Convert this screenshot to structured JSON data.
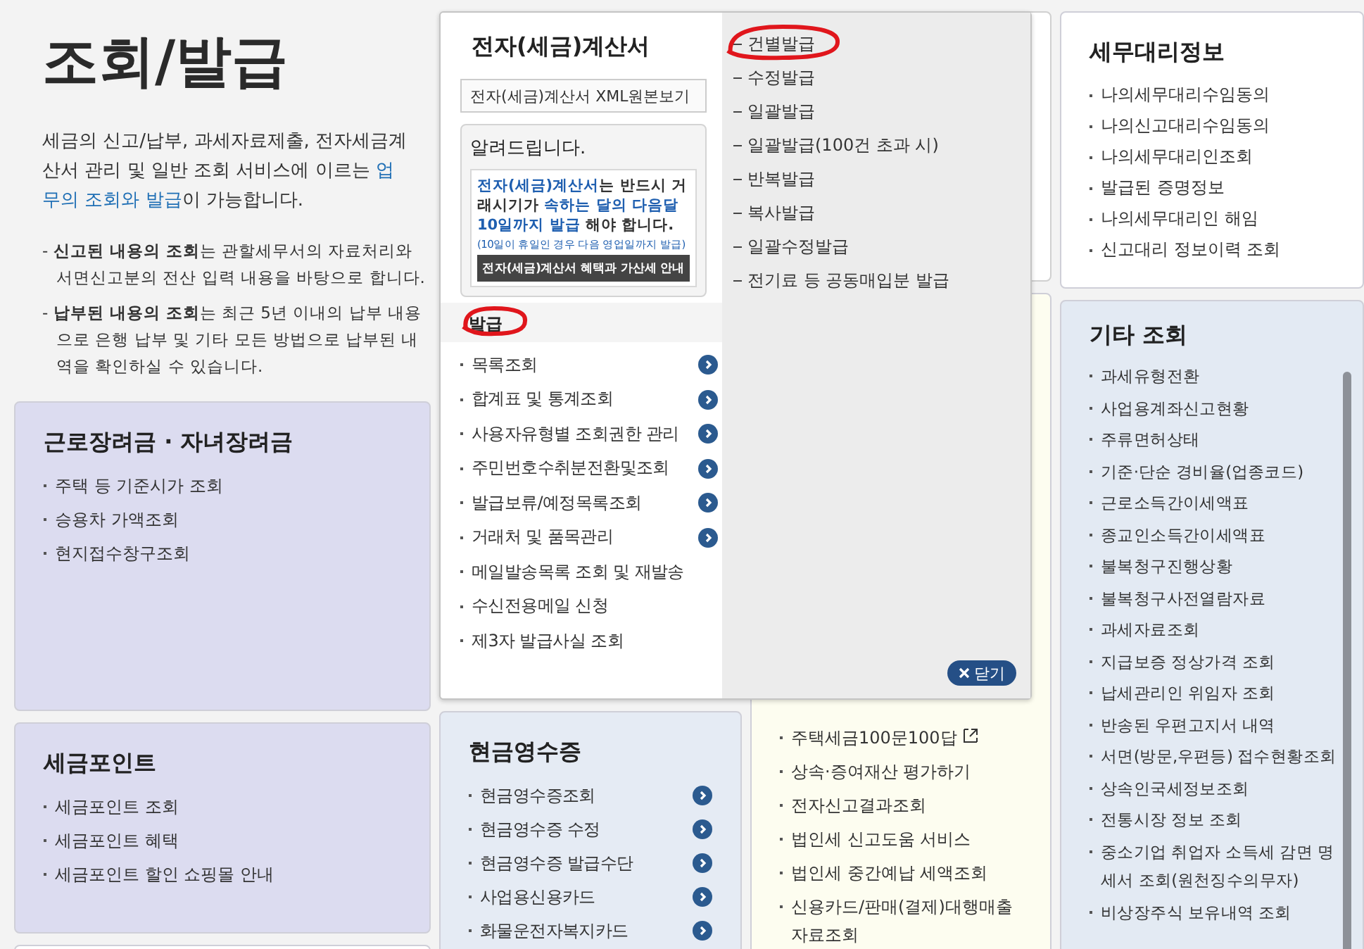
{
  "intro": {
    "title": "조회/발급",
    "description": "세금의 신고/납부, 과세자료제출, 전자세금계산서 관리 및 일반 조회 서비스에 이르는 **업무의 조회와 발급**이 가능합니다.",
    "notes": [
      "- **신고된 내용의 조회**는 관할세무서의 자료처리와 서면신고분의 전산 입력 내용을 바탕으로 합니다.",
      "- **납부된 내용의 조회**는 최근 5년 이내의 납부 내용으로 은행 납부 및 기타 모든 방법으로 납부된 내역을 확인하실 수 있습니다."
    ]
  },
  "left_cards": [
    {
      "title": "근로장려금 · 자녀장려금",
      "items": [
        "주택 등 기준시가 조회",
        "승용차 가액조회",
        "현지접수창구조회"
      ]
    },
    {
      "title": "세금포인트",
      "items": [
        "세금포인트 조회",
        "세금포인트 혜택",
        "세금포인트 할인 쇼핑몰 안내"
      ]
    }
  ],
  "popup": {
    "title": "전자(세금)계산서",
    "xml_button": "전자(세금)계산서 XML원본보기",
    "notice": {
      "title": "알려드립니다.",
      "text": "**전자(세금)계산서**는 반드시 거래시기가 **속하는 달의 다음달 10일까지 발급** 해야 합니다.",
      "footnote": "(10일이 휴일인 경우 다음 영업일까지 발급)",
      "button": "전자(세금)계산서 혜택과 가산세 안내"
    },
    "section": {
      "label": "발급",
      "highlighted": true
    },
    "menu": [
      {
        "label": "목록조회",
        "has_arrow": true
      },
      {
        "label": "합계표 및 통계조회",
        "has_arrow": true
      },
      {
        "label": "사용자유형별 조회권한 관리",
        "has_arrow": true
      },
      {
        "label": "주민번호수취분전환및조회",
        "has_arrow": true
      },
      {
        "label": "발급보류/예정목록조회",
        "has_arrow": true
      },
      {
        "label": "거래처 및 품목관리",
        "has_arrow": true
      },
      {
        "label": "메일발송목록 조회 및 재발송",
        "has_arrow": false
      },
      {
        "label": "수신전용메일 신청",
        "has_arrow": false
      },
      {
        "label": "제3자 발급사실 조회",
        "has_arrow": false
      }
    ],
    "submenu": [
      {
        "label": "건별발급",
        "highlighted": true
      },
      {
        "label": "수정발급",
        "highlighted": false
      },
      {
        "label": "일괄발급",
        "highlighted": false
      },
      {
        "label": "일괄발급(100건 초과 시)",
        "highlighted": false
      },
      {
        "label": "반복발급",
        "highlighted": false
      },
      {
        "label": "복사발급",
        "highlighted": false
      },
      {
        "label": "일괄수정발급",
        "highlighted": false
      },
      {
        "label": "전기료 등 공동매입분 발급",
        "highlighted": false
      }
    ],
    "close_button": "닫기"
  },
  "cash_receipt": {
    "title": "현금영수증",
    "items": [
      "현금영수증조회",
      "현금영수증 수정",
      "현금영수증 발급수단",
      "사업용신용카드",
      "화물운전자복지카드"
    ]
  },
  "middle_list": [
    {
      "label": "주택세금100문100답",
      "external": true
    },
    {
      "label": "상속·증여재산 평가하기",
      "external": false
    },
    {
      "label": "전자신고결과조회",
      "external": false
    },
    {
      "label": "법인세 신고도움 서비스",
      "external": false
    },
    {
      "label": "법인세 중간예납 세액조회",
      "external": false
    },
    {
      "label": "신용카드/판매(결제)대행매출 자료조회",
      "external": false
    }
  ],
  "agent_card": {
    "title": "세무대리정보",
    "items": [
      "나의세무대리수임동의",
      "나의신고대리수임동의",
      "나의세무대리인조회",
      "발급된 증명정보",
      "나의세무대리인 해임",
      "신고대리 정보이력 조회"
    ]
  },
  "other_card": {
    "title": "기타 조회",
    "items": [
      "과세유형전환",
      "사업용계좌신고현황",
      "주류면허상태",
      "기준·단순 경비율(업종코드)",
      "근로소득간이세액표",
      "종교인소득간이세액표",
      "불복청구진행상황",
      "불복청구사전열람자료",
      "과세자료조회",
      "지급보증 정상가격 조회",
      "납세관리인 위임자 조회",
      "반송된 우편고지서 내역",
      "서면(방문,우편등) 접수현황조회",
      "상속인국세정보조회",
      "전통시장 정보 조회",
      "중소기업 취업자 소득세 감면 명세서 조회(원천징수의무자)",
      "비상장주식 보유내역 조회"
    ]
  }
}
